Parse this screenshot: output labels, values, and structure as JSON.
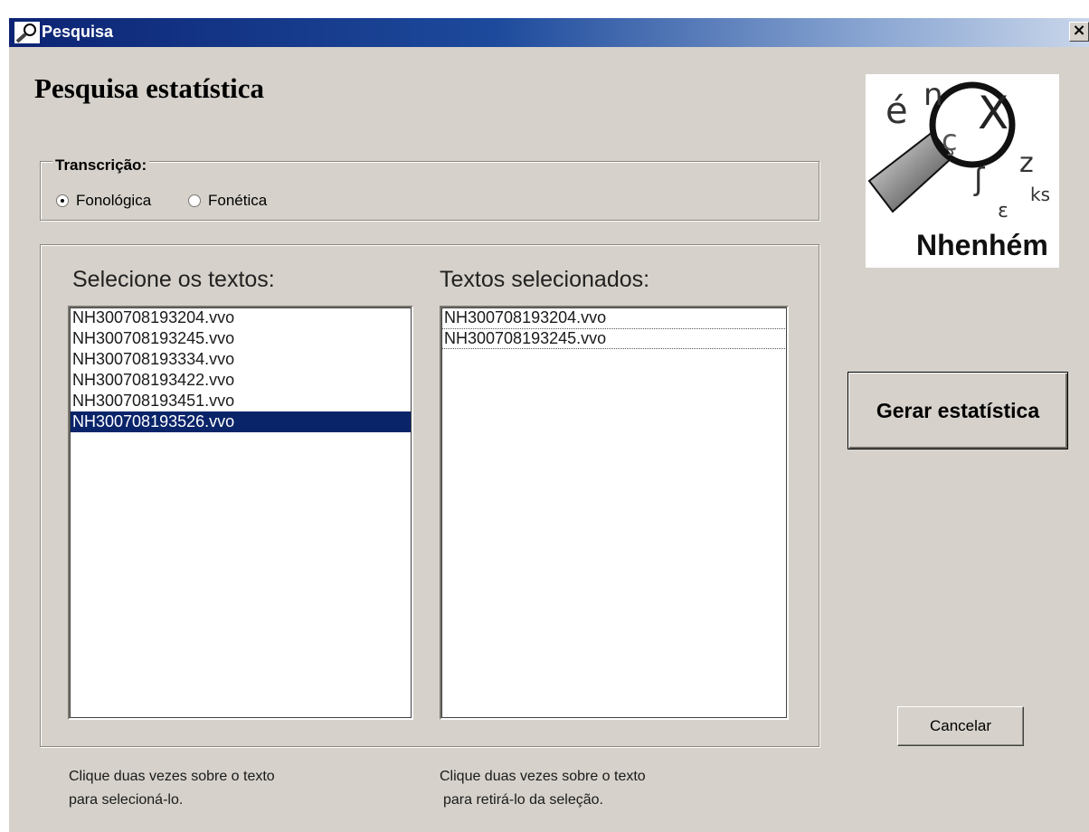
{
  "window": {
    "title": "Pesquisa",
    "close_label": "×"
  },
  "heading": "Pesquisa estatística",
  "transcription": {
    "legend": "Transcrição:",
    "options": [
      {
        "label": "Fonológica",
        "checked": true
      },
      {
        "label": "Fonética",
        "checked": false
      }
    ]
  },
  "available": {
    "label": "Selecione os textos:",
    "items": [
      "NH300708193204.vvo",
      "NH300708193245.vvo",
      "NH300708193334.vvo",
      "NH300708193422.vvo",
      "NH300708193451.vvo",
      "NH300708193526.vvo"
    ],
    "selected_index": 5,
    "hint_line1": "Clique duas vezes sobre o texto",
    "hint_line2": "para selecioná-lo."
  },
  "chosen": {
    "label": "Textos selecionados:",
    "items": [
      "NH300708193204.vvo",
      "NH300708193245.vvo"
    ],
    "focused_index": 1,
    "hint_line1": "Clique duas vezes sobre o texto",
    "hint_line2": "para retirá-lo da seleção."
  },
  "logo": {
    "icon": "magnifier-logo",
    "letters": [
      "é",
      "n",
      "ç",
      "X",
      "z",
      "ks",
      "ʃ",
      "ɛ"
    ],
    "wordmark": "Nhenhém"
  },
  "buttons": {
    "generate": "Gerar estatística",
    "cancel": "Cancelar"
  },
  "colors": {
    "title_bar": "#0d2474",
    "selection": "#0a246a",
    "dialog_bg": "#d6d2cb"
  }
}
